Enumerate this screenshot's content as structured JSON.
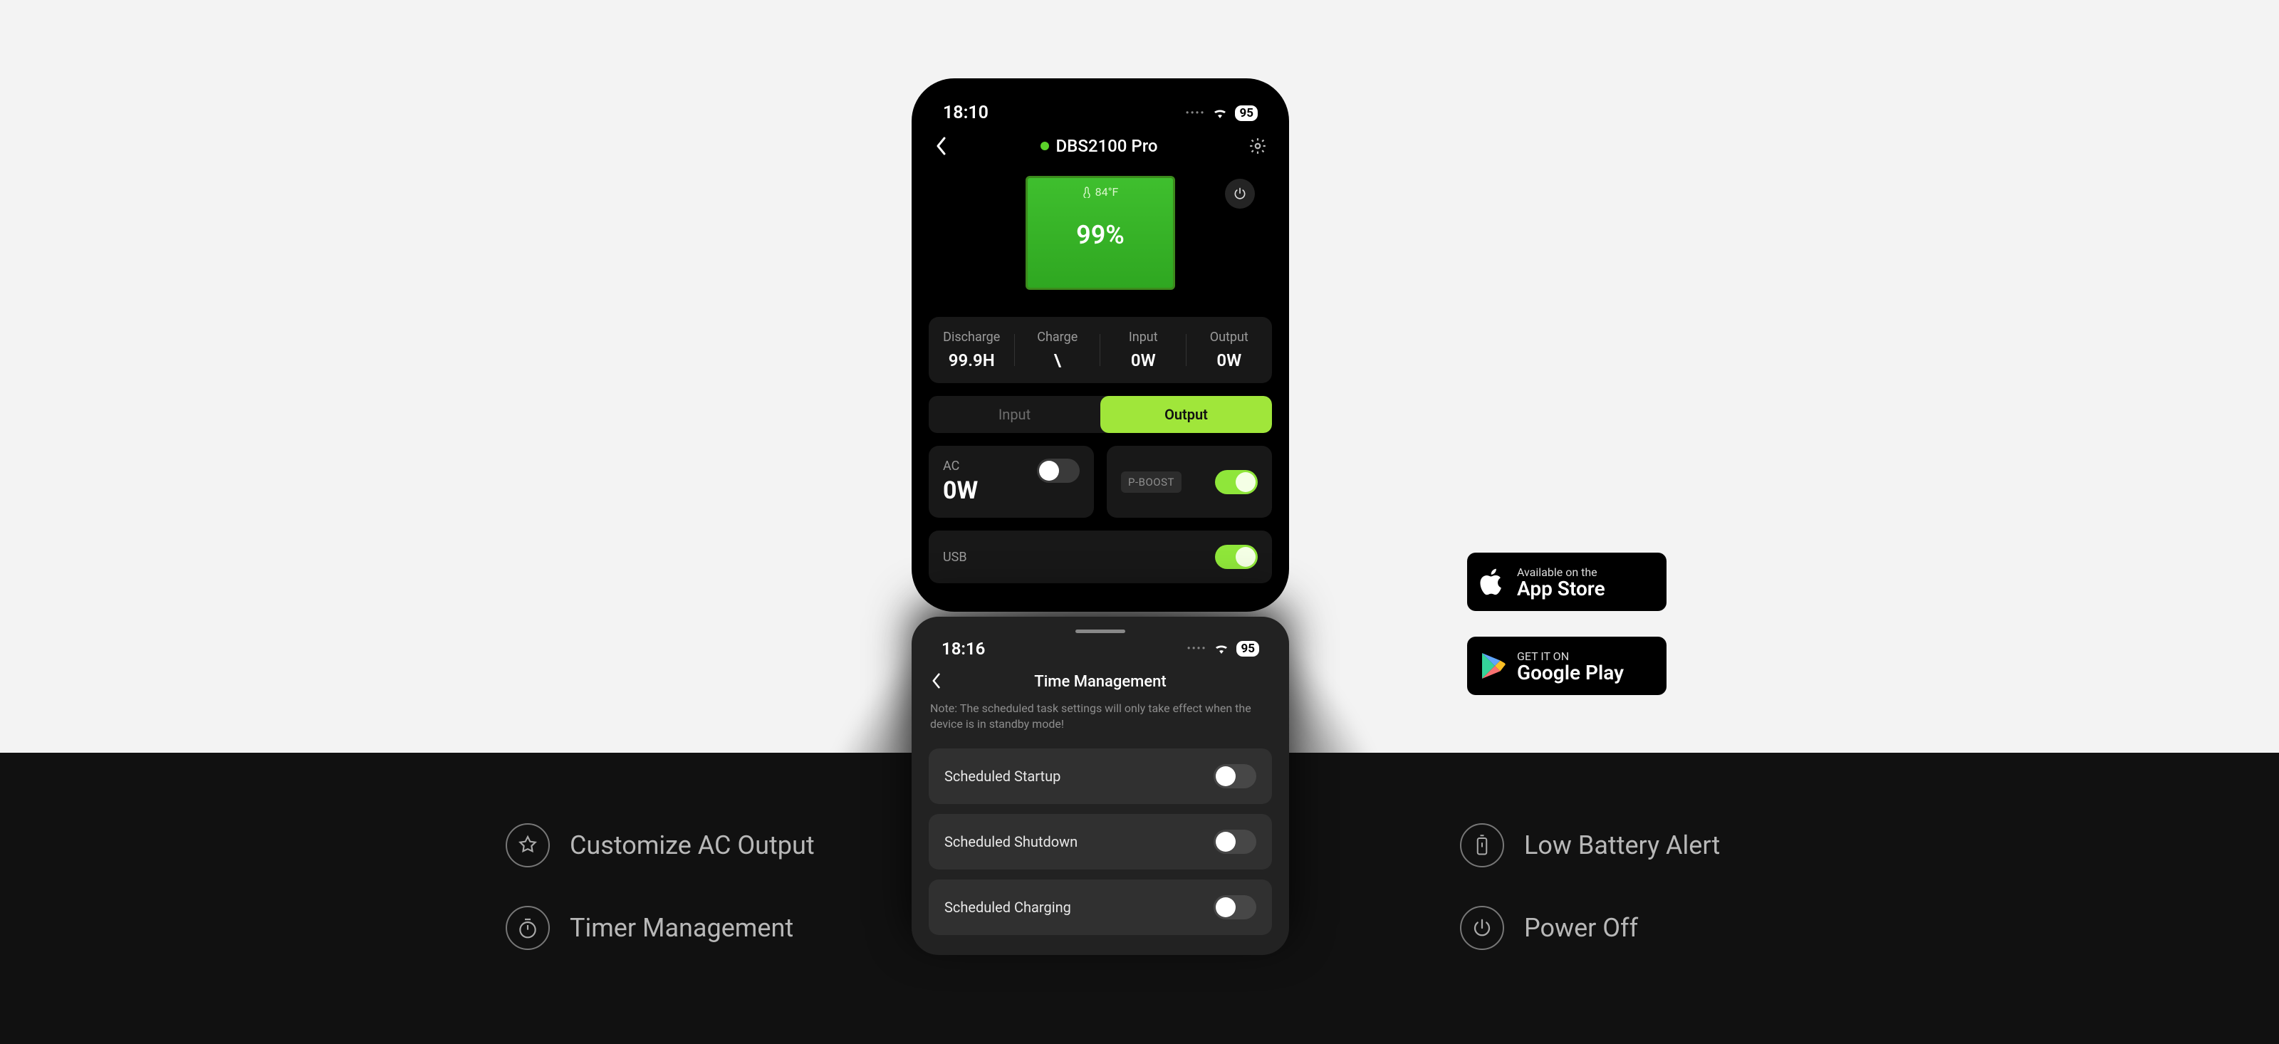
{
  "phone": {
    "status": {
      "time": "18:10",
      "battery_pct": "95"
    },
    "device_name": "DBS2100 Pro",
    "temperature": "84°F",
    "soc_pct": "99%",
    "stats": {
      "discharge": {
        "label": "Discharge",
        "value": "99.9H"
      },
      "charge": {
        "label": "Charge",
        "value": "\\"
      },
      "input": {
        "label": "Input",
        "value": "0W"
      },
      "output": {
        "label": "Output",
        "value": "0W"
      }
    },
    "segment": {
      "input": "Input",
      "output": "Output"
    },
    "ac": {
      "label": "AC",
      "value": "0W"
    },
    "pboost_label": "P-BOOST",
    "usb_label": "USB"
  },
  "sheet": {
    "status": {
      "time": "18:16",
      "battery_pct": "95"
    },
    "title": "Time Management",
    "note": "Note: The scheduled task settings will only take effect when the device is in standby mode!",
    "rows": {
      "startup": "Scheduled Startup",
      "shutdown": "Scheduled Shutdown",
      "charging": "Scheduled Charging"
    }
  },
  "badges": {
    "appstore": {
      "line1": "Available on the",
      "line2": "App Store"
    },
    "playstore": {
      "line1": "GET IT ON",
      "line2": "Google Play"
    }
  },
  "features": {
    "f1": "Customize AC Output",
    "f2": "Timer Management",
    "f3": "Low Battery Alert",
    "f4": "Power Off"
  }
}
